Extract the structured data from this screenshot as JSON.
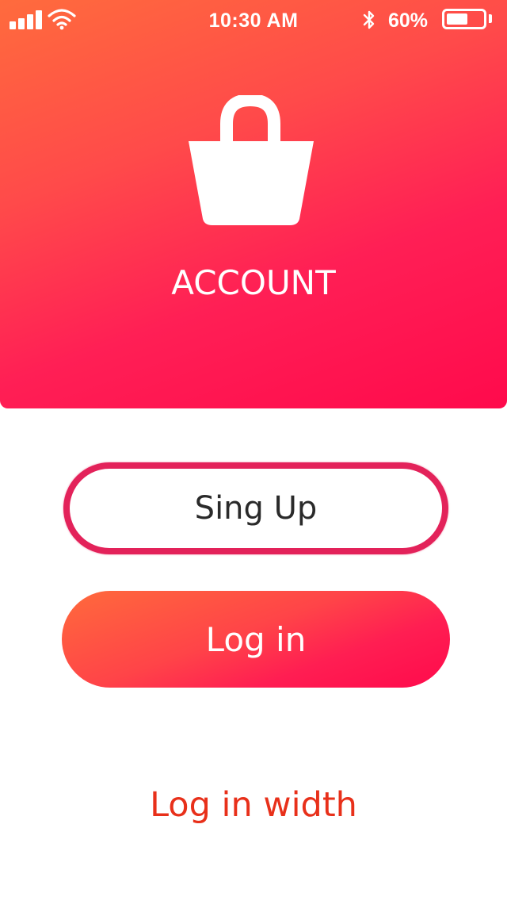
{
  "status_bar": {
    "time": "10:30 AM",
    "battery_percent": "60%",
    "battery_level": 0.6,
    "icons": [
      "signal-icon",
      "wifi-icon",
      "bluetooth-icon",
      "battery-icon"
    ]
  },
  "hero": {
    "icon": "shopping-bag-icon",
    "title": "ACCOUNT",
    "gradient_start": "#ff6b3d",
    "gradient_end": "#ff0a4c"
  },
  "actions": {
    "signup_label": "Sing Up",
    "login_label": "Log in",
    "login_with_label": "Log in width",
    "signup_border_color": "#e3225a",
    "login_with_color": "#e8301a"
  }
}
